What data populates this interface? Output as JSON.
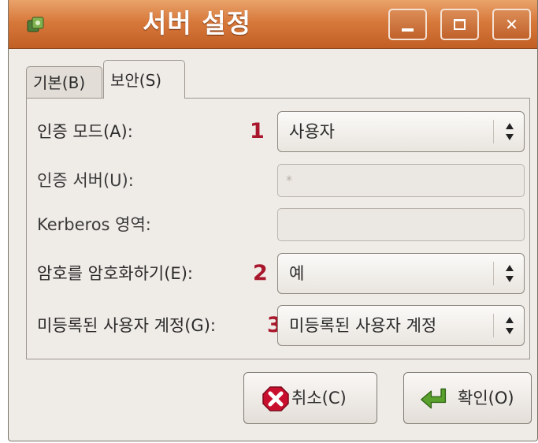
{
  "window": {
    "title": "서버 설정",
    "minimize_symbol": "",
    "maximize_symbol": "",
    "close_symbol": "✕",
    "accent": "#d8793c"
  },
  "tabs": [
    {
      "label": "기본(B)"
    },
    {
      "label": "보안(S)"
    }
  ],
  "form": {
    "auth_mode": {
      "label": "인증 모드(A):",
      "marker": "1",
      "value": "사용자"
    },
    "auth_server": {
      "label": "인증 서버(U):",
      "value": "*"
    },
    "kerberos_realm": {
      "label": "Kerberos 영역:",
      "value": ""
    },
    "encrypt_passwords": {
      "label": "암호를 암호화하기(E):",
      "marker": "2",
      "value": "예"
    },
    "guest_account": {
      "label": "미등록된 사용자 계정(G):",
      "marker": "3",
      "value": "미등록된 사용자 계정"
    }
  },
  "buttons": {
    "cancel": "취소(C)",
    "ok": "확인(O)"
  },
  "colors": {
    "marker": "#a9172c",
    "cancel_icon": "#c8102e",
    "ok_icon": "#5aa02c"
  }
}
